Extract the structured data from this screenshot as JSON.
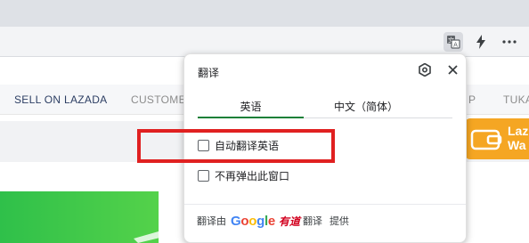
{
  "browser": {
    "toolbar": {
      "translate_icon": "translate-icon",
      "extensions_icon": "lightning-icon",
      "menu_icon": "more-horizontal-icon"
    }
  },
  "page": {
    "nav": {
      "items": [
        {
          "label": "SELL ON LAZADA"
        },
        {
          "label": "CUSTOMER"
        },
        {
          "label": "P"
        },
        {
          "label": "TUKA"
        }
      ]
    },
    "wallet_banner": {
      "line1": "Laz",
      "line2": "Wa",
      "color": "#f5a623"
    },
    "banner_color": "#2fc04a"
  },
  "translate_popup": {
    "title": "翻译",
    "tabs": [
      {
        "label": "英语",
        "selected": true
      },
      {
        "label": "中文（简体）",
        "selected": false
      }
    ],
    "options": [
      {
        "label": "自动翻译英语",
        "checked": false
      },
      {
        "label": "不再弹出此窗口",
        "checked": false
      }
    ],
    "footer": {
      "prefix": "翻译由",
      "google": "Google",
      "youdao": "有道",
      "translate_word": "翻译",
      "suffix": "提供"
    },
    "accent_color": "#188038"
  },
  "highlight_color": "#e02020"
}
